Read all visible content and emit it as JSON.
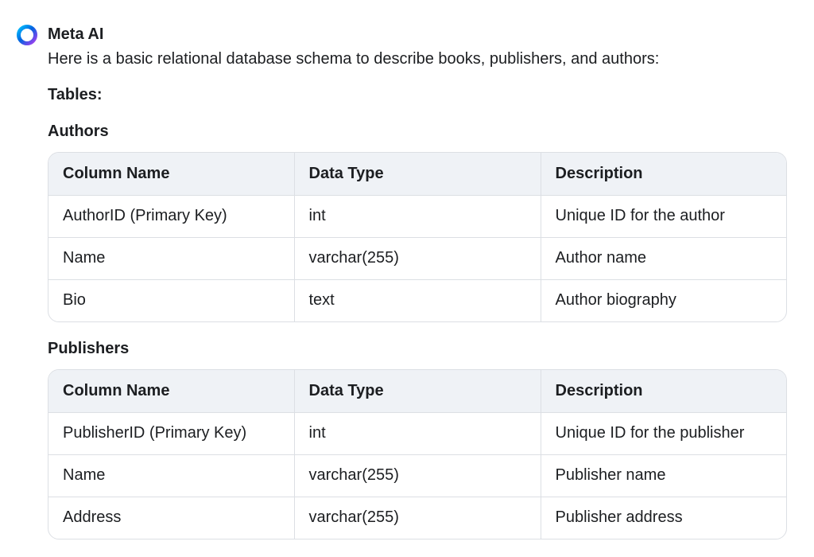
{
  "assistant": {
    "name": "Meta AI",
    "avatar_icon": "meta-ai-ring-icon",
    "avatar_colors": [
      "#0064e0",
      "#a83cf0",
      "#00c2ff"
    ]
  },
  "message": {
    "intro": "Here is a basic relational database schema to describe books, publishers, and authors:",
    "tables_label": "Tables:",
    "tables": [
      {
        "title": "Authors",
        "headers": [
          "Column Name",
          "Data Type",
          "Description"
        ],
        "rows": [
          [
            "AuthorID (Primary Key)",
            "int",
            "Unique ID for the author"
          ],
          [
            "Name",
            "varchar(255)",
            "Author name"
          ],
          [
            "Bio",
            "text",
            "Author biography"
          ]
        ]
      },
      {
        "title": "Publishers",
        "headers": [
          "Column Name",
          "Data Type",
          "Description"
        ],
        "rows": [
          [
            "PublisherID (Primary Key)",
            "int",
            "Unique ID for the publisher"
          ],
          [
            "Name",
            "varchar(255)",
            "Publisher name"
          ],
          [
            "Address",
            "varchar(255)",
            "Publisher address"
          ]
        ]
      }
    ]
  }
}
